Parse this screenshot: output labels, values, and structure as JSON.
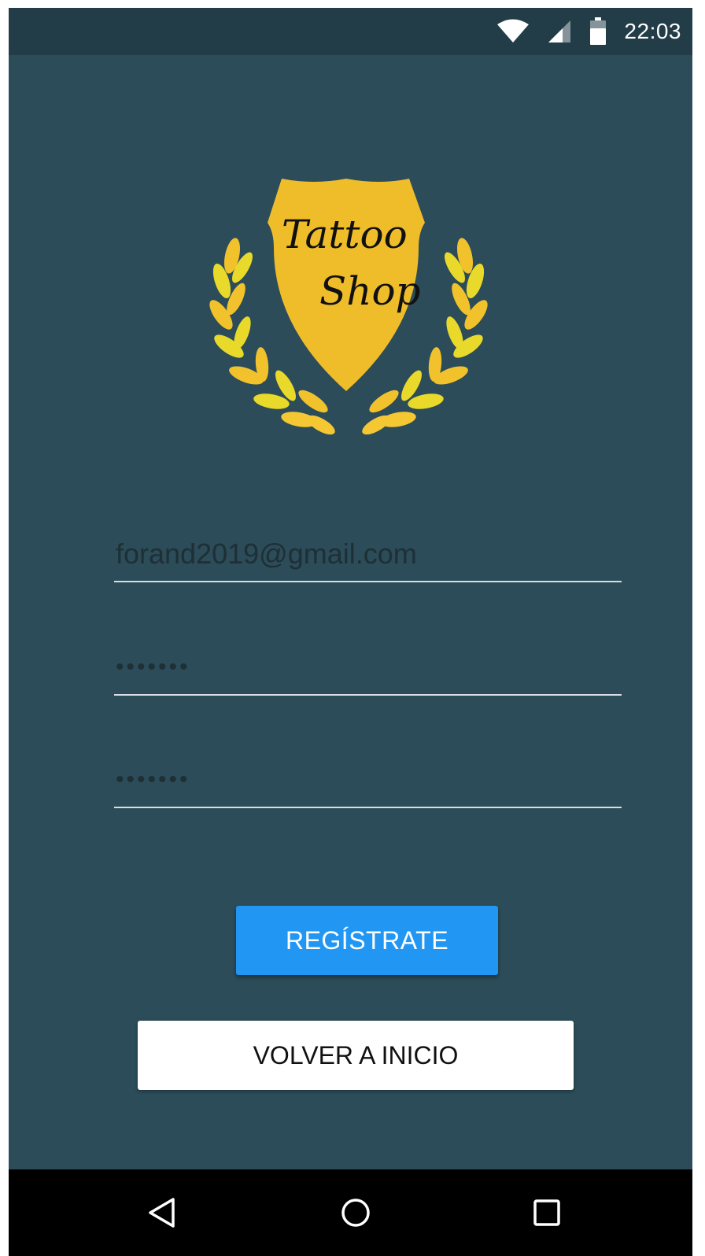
{
  "status_bar": {
    "time": "22:03",
    "icons": [
      "wifi-icon",
      "cell-signal-icon",
      "battery-icon"
    ]
  },
  "logo": {
    "line1": "Tattoo",
    "line2": "Shop",
    "shield_color": "#f0bd2a",
    "laurel_color": "#f2c22c"
  },
  "form": {
    "email_value": "forand2019@gmail.com",
    "password_value": "•••••••",
    "confirm_password_value": "•••••••"
  },
  "buttons": {
    "register_label": "REGÍSTRATE",
    "back_label": "VOLVER A INICIO"
  },
  "nav_bar": {
    "icons": [
      "back-icon",
      "home-icon",
      "recents-icon"
    ]
  },
  "colors": {
    "background": "#2b4c58",
    "status_bar": "#223d47",
    "accent": "#2196f3"
  }
}
